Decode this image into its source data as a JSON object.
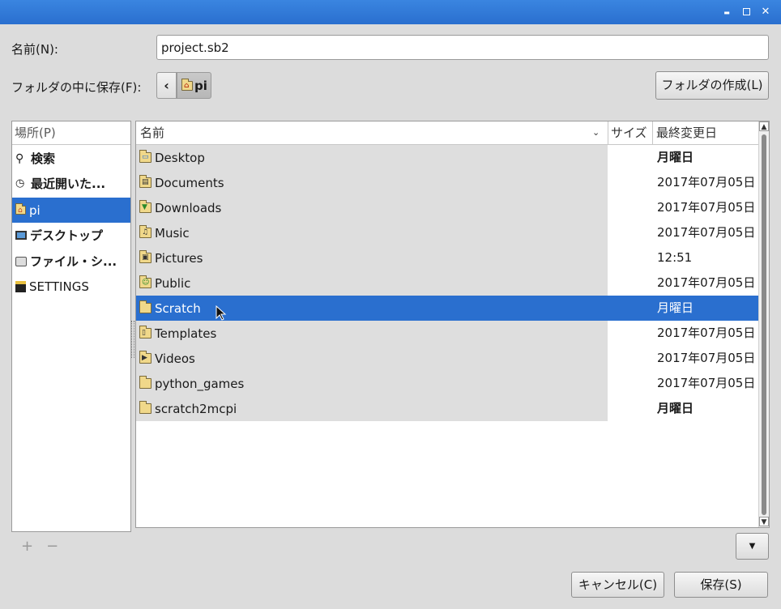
{
  "form": {
    "name_label": "名前(N):",
    "name_value": "project.sb2",
    "folder_label": "フォルダの中に保存(F):",
    "back_glyph": "‹",
    "path_current": "pi",
    "create_folder_label": "フォルダの作成(L)"
  },
  "places": {
    "header": "場所(P)",
    "items": [
      {
        "label": "検索",
        "icon": "search-icon"
      },
      {
        "label": "最近開いた...",
        "icon": "recent-icon"
      },
      {
        "label": "pi",
        "icon": "home-icon"
      },
      {
        "label": "デスクトップ",
        "icon": "desktop-icon"
      },
      {
        "label": "ファイル・シ...",
        "icon": "drive-icon"
      },
      {
        "label": "SETTINGS",
        "icon": "usb-drive-icon"
      }
    ]
  },
  "files": {
    "columns": {
      "name": "名前",
      "size": "サイズ",
      "modified": "最終変更日"
    },
    "rows": [
      {
        "name": "Desktop",
        "modified": "月曜日",
        "icon": "folder-desktop-icon"
      },
      {
        "name": "Documents",
        "modified": "2017年07月05日",
        "icon": "folder-documents-icon"
      },
      {
        "name": "Downloads",
        "modified": "2017年07月05日",
        "icon": "folder-downloads-icon"
      },
      {
        "name": "Music",
        "modified": "2017年07月05日",
        "icon": "folder-music-icon"
      },
      {
        "name": "Pictures",
        "modified": "12:51",
        "icon": "folder-pictures-icon"
      },
      {
        "name": "Public",
        "modified": "2017年07月05日",
        "icon": "folder-public-icon"
      },
      {
        "name": "Scratch",
        "modified": "月曜日",
        "icon": "folder-icon"
      },
      {
        "name": "Templates",
        "modified": "2017年07月05日",
        "icon": "folder-templates-icon"
      },
      {
        "name": "Videos",
        "modified": "2017年07月05日",
        "icon": "folder-videos-icon"
      },
      {
        "name": "python_games",
        "modified": "2017年07月05日",
        "icon": "folder-icon"
      },
      {
        "name": "scratch2mcpi",
        "modified": "月曜日",
        "icon": "folder-icon"
      }
    ]
  },
  "footer": {
    "add_glyph": "+",
    "remove_glyph": "−",
    "dropdown_glyph": "▼",
    "cancel_label": "キャンセル(C)",
    "save_label": "保存(S)"
  },
  "window": {
    "minimize_glyph": "▬",
    "close_glyph": "✕"
  },
  "colors": {
    "titlebar": "#2a6fcf",
    "selection": "#2a6fcf"
  }
}
